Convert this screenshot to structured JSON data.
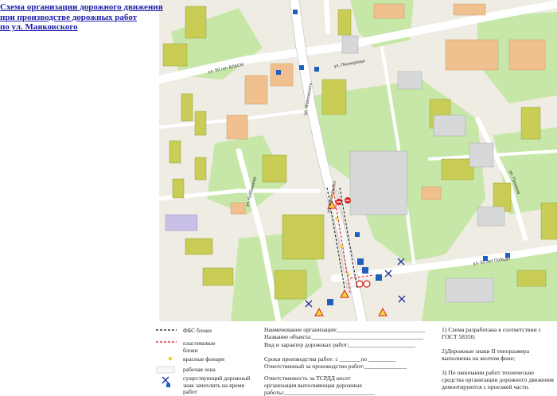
{
  "title_lines": [
    "Схема организации дорожного движения",
    "при производстве дорожных работ",
    "по ул. Маяковского"
  ],
  "map": {
    "streets": {
      "s50vlksm": "ул. 50 лет ВЛКСМ",
      "mayakovskogo_n": "ул. Маяковского",
      "mayakovskogo_s": "ул. Маяковского",
      "kuybysheva": "ул. Куйбышева",
      "s50pobedy": "ул. 50 лет Победы",
      "pionerskaya": "ул. Пионерская",
      "pushkina": "ул. Пушкина"
    }
  },
  "legend": {
    "fbs": "ФБС блоки",
    "plastic": "пластиковые блоки",
    "lights": "красные фонари",
    "work_zone": "рабочая зона",
    "existing_sign": "существующий дорожный знак зачехлить на время работ"
  },
  "form": {
    "org": "Наименование организации:_____________________________",
    "object": "Название объекта:_____________________________________",
    "work_type": "Вид и характер дорожных работ:______________________",
    "dates": "Сроки производства работ: с _______по _________",
    "responsible": "Ответственный за производство работ:______________",
    "tsodd": "Ответственность за ТСРДД несет",
    "tsodd2": "организация выполняющая дорожные",
    "tsodd3": "работы:______________________________"
  },
  "notes": [
    "1) Схема разработана в соответствии с ГОСТ 58350;",
    "2)Дорожные знаки II типоразмера выполнены на желтом фоне;",
    "3) По окончании работ технические средства организации дорожного движения демонтируются с проезжей части."
  ],
  "colors": {
    "green": "#c7e7a9",
    "road": "#ffffff",
    "block": "#efece4",
    "yellow_bldg": "#c9cd55",
    "orange_bldg": "#f0c18e",
    "gray_bldg": "#d7d8d9",
    "lilac_bldg": "#c8c0e6",
    "fbs": "#111111",
    "plastic": "#dd1111",
    "lamp": "#f2d21c"
  }
}
